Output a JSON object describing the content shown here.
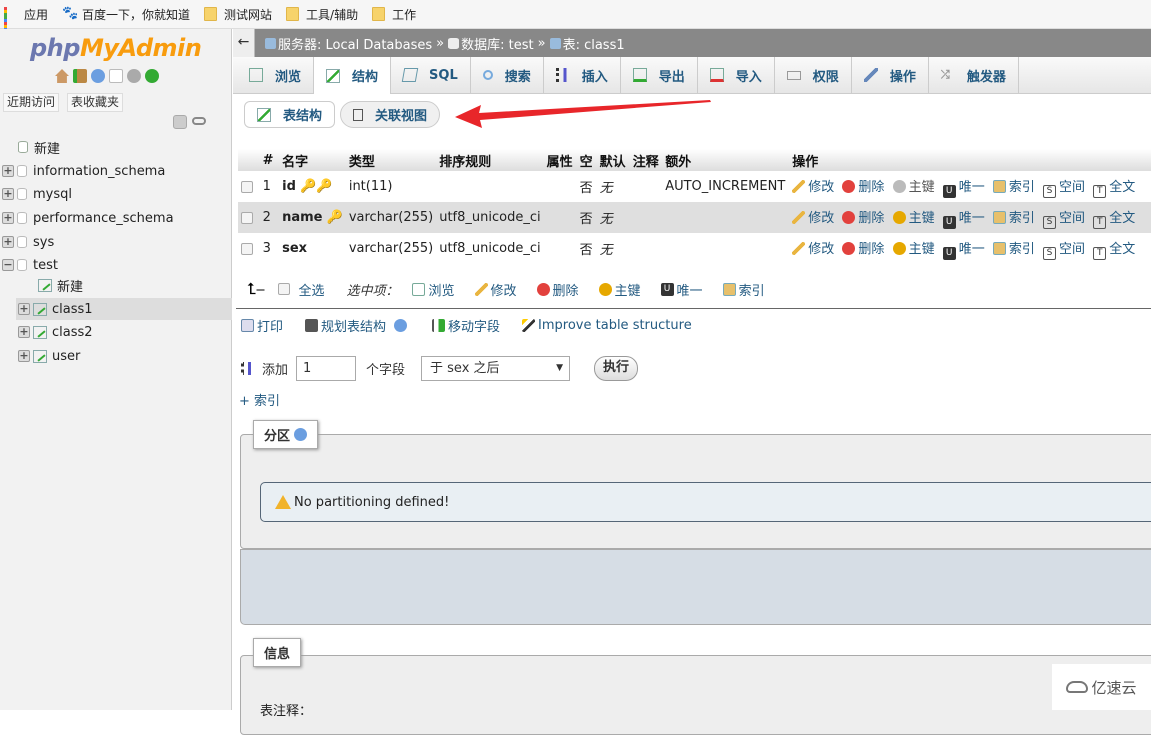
{
  "bookmarks": [
    {
      "icon": "apps-grid-icon",
      "label": "应用"
    },
    {
      "icon": "baidu-paw-icon",
      "label": "百度一下，你就知道"
    },
    {
      "icon": "folder-icon",
      "label": "测试网站"
    },
    {
      "icon": "folder-icon",
      "label": "工具/辅助"
    },
    {
      "icon": "folder-icon",
      "label": "工作"
    }
  ],
  "sidebar": {
    "logo_php": "php",
    "logo_myadmin": "MyAdmin",
    "tab_recent": "近期访问",
    "tab_favorites": "表收藏夹",
    "tree": {
      "new": "新建",
      "databases": [
        "information_schema",
        "mysql",
        "performance_schema",
        "sys",
        "test"
      ],
      "test_new": "新建",
      "tables": [
        "class1",
        "class2",
        "user"
      ],
      "selected_table": "class1"
    }
  },
  "breadcrumb": {
    "back": "←",
    "server": "服务器: Local Databases",
    "sep": "»",
    "database": "数据库: test",
    "table": "表: class1"
  },
  "tabs": [
    "浏览",
    "结构",
    "SQL",
    "搜索",
    "插入",
    "导出",
    "导入",
    "权限",
    "操作",
    "触发器"
  ],
  "active_tab": "结构",
  "subtabs": {
    "structure": "表结构",
    "relation": "关联视图"
  },
  "table": {
    "headers": [
      "#",
      "名字",
      "类型",
      "排序规则",
      "属性",
      "空",
      "默认",
      "注释",
      "额外",
      "操作"
    ],
    "rows": [
      {
        "num": "1",
        "name": "id",
        "type": "int(11)",
        "collation": "",
        "attr": "",
        "null": "否",
        "default": "无",
        "comment": "",
        "extra": "AUTO_INCREMENT"
      },
      {
        "num": "2",
        "name": "name",
        "type": "varchar(255)",
        "collation": "utf8_unicode_ci",
        "attr": "",
        "null": "否",
        "default": "无",
        "comment": "",
        "extra": ""
      },
      {
        "num": "3",
        "name": "sex",
        "type": "varchar(255)",
        "collation": "utf8_unicode_ci",
        "attr": "",
        "null": "否",
        "default": "无",
        "comment": "",
        "extra": ""
      }
    ],
    "actions": [
      "修改",
      "删除",
      "主键",
      "唯一",
      "索引",
      "空间",
      "全文"
    ]
  },
  "bulk": {
    "select_all": "全选",
    "with_selected": "选中项：",
    "actions": [
      "浏览",
      "修改",
      "删除",
      "主键",
      "唯一",
      "索引"
    ]
  },
  "tools": {
    "print": "打印",
    "propose": "规划表结构",
    "move": "移动字段",
    "improve": "Improve table structure"
  },
  "add_field": {
    "label": "添加",
    "count": "1",
    "unit": "个字段",
    "position": "于 sex 之后",
    "go": "执行"
  },
  "add_index": "+ 索引",
  "partition": {
    "legend": "分区",
    "notice": "No partitioning defined!"
  },
  "info": {
    "legend": "信息",
    "comment_label": "表注释："
  },
  "watermark": "亿速云"
}
